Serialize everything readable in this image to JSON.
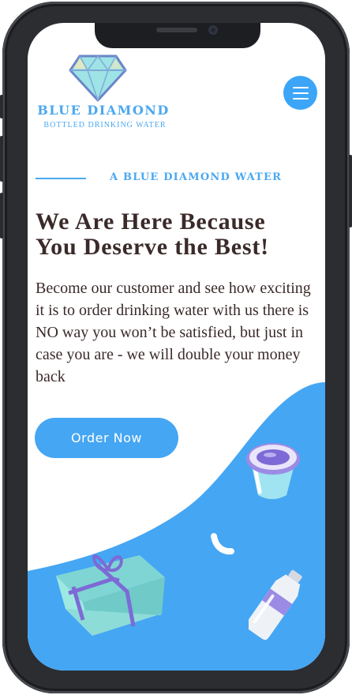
{
  "brand": {
    "name": "BLUE DIAMOND",
    "tagline": "BOTTLED DRINKING WATER",
    "logo_icon": "diamond-icon"
  },
  "header": {
    "menu_icon": "hamburger-menu-icon"
  },
  "hero": {
    "eyebrow": "A BLUE DIAMOND WATER",
    "headline": "We Are Here Because You Deserve the Best!",
    "body": "Become our customer and see how exciting it is to order drinking water with us there is NO way you won’t be satisfied, but just in case you are - we will double your money back",
    "cta_label": "Order Now"
  },
  "illustrations": [
    "water-cup-icon",
    "water-drop-icon",
    "gift-box-icon",
    "water-bottle-icon"
  ],
  "colors": {
    "accent": "#45a6f3",
    "heading_text": "#3b2a2a",
    "wave": "#45a6f3",
    "device_frame": "#2b2d31"
  }
}
